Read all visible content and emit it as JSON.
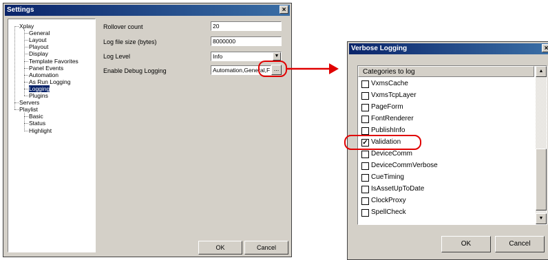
{
  "settings": {
    "title": "Settings",
    "close_glyph": "×",
    "tree": [
      {
        "label": "Xplay",
        "level": 0
      },
      {
        "label": "General",
        "level": 1
      },
      {
        "label": "Layout",
        "level": 1
      },
      {
        "label": "Playout",
        "level": 1
      },
      {
        "label": "Display",
        "level": 1
      },
      {
        "label": "Template Favorites",
        "level": 1
      },
      {
        "label": "Panel Events",
        "level": 1
      },
      {
        "label": "Automation",
        "level": 1
      },
      {
        "label": "As Run Logging",
        "level": 1
      },
      {
        "label": "Logging",
        "level": 1,
        "selected": true
      },
      {
        "label": "Plugins",
        "level": 1
      },
      {
        "label": "Servers",
        "level": 0
      },
      {
        "label": "Playlist",
        "level": 0
      },
      {
        "label": "Basic",
        "level": 1
      },
      {
        "label": "Status",
        "level": 1
      },
      {
        "label": "Highlight",
        "level": 1
      }
    ],
    "fields": {
      "rollover_label": "Rollover count",
      "rollover_value": "20",
      "filesize_label": "Log file size (bytes)",
      "filesize_value": "8000000",
      "loglevel_label": "Log Level",
      "loglevel_value": "Info",
      "debug_label": "Enable Debug Logging",
      "debug_value": "Automation,General,F",
      "ellipsis": "..."
    },
    "ok_label": "OK",
    "cancel_label": "Cancel"
  },
  "verbose": {
    "title": "Verbose Logging",
    "close_glyph": "×",
    "list_header": "Categories to log",
    "items": [
      {
        "label": "VxmsCache",
        "checked": false
      },
      {
        "label": "VxmsTcpLayer",
        "checked": false
      },
      {
        "label": "PageForm",
        "checked": false
      },
      {
        "label": "FontRenderer",
        "checked": false
      },
      {
        "label": "PublishInfo",
        "checked": false
      },
      {
        "label": "Validation",
        "checked": true
      },
      {
        "label": "DeviceComm",
        "checked": false
      },
      {
        "label": "DeviceCommVerbose",
        "checked": false
      },
      {
        "label": "CueTiming",
        "checked": false
      },
      {
        "label": "IsAssetUpToDate",
        "checked": false
      },
      {
        "label": "ClockProxy",
        "checked": false
      },
      {
        "label": "SpellCheck",
        "checked": false
      }
    ],
    "ok_label": "OK",
    "cancel_label": "Cancel"
  },
  "colors": {
    "title_bar": "#0a246a",
    "dialog_face": "#d4d0c8",
    "selection": "#0a246a",
    "annotation": "#e00000"
  }
}
